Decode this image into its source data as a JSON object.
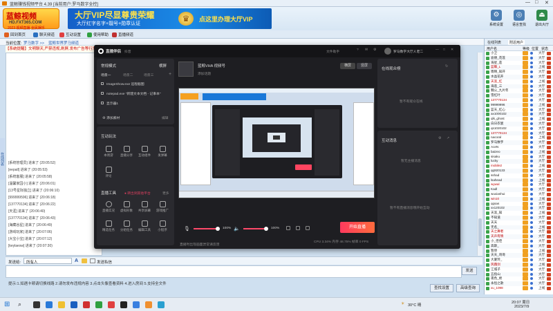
{
  "window": {
    "title": "蓝鲸赚钱视频平台 4.39 [当前用户:罗马数字全控]",
    "minimize": "—",
    "maximize": "□",
    "close": "✕"
  },
  "logo": {
    "line1": "蓝鲸视频",
    "line2": "HD.FXT365.COM",
    "line3": "2023 视频直播 全民娱乐"
  },
  "banner": {
    "line1": "大厅VIP尽显尊贵荣耀",
    "line2": "大厅红字名字+靓号+勋章认证",
    "line3": "点这里办理大厅VIP"
  },
  "topbuttons": [
    {
      "label": "系统设置",
      "icon": "gear-icon"
    },
    {
      "label": "语言查找",
      "icon": "globe-icon"
    },
    {
      "label": "退出大厅",
      "icon": "exit-icon"
    }
  ],
  "toolbar": {
    "items": [
      {
        "label": "回到首页",
        "color": "#e06020"
      },
      {
        "label": "聊天频道",
        "color": "#2a70c0"
      },
      {
        "label": "互动设置",
        "color": "#e04040"
      },
      {
        "label": "使用帮助",
        "color": "#30a040"
      },
      {
        "label": "直播频道",
        "color": "#c03030"
      }
    ]
  },
  "crumb": {
    "a": "当前位置:",
    "b": "罗马数字 >>",
    "c": "蓝鲸世界罗马频道"
  },
  "ticker": "【系统提醒】文明聊天,严禁违规,刷屏,发布广告等行为",
  "chat": [
    "[系统管理员] 进来了 (20:05:52)",
    "[eepall] 进来了 (20:05:53)",
    "[系统客服] 进来了 (20:05:58)",
    "[温馨家园小] 进来了 (20:06:01)",
    "[13号星际独立] 进来了 (20:06:10)",
    "[999999596] 进来了 (20:06:18)",
    "[137770134] 进来了 (20:06:22)",
    "[天涯] 进来了 (20:06:40)",
    "[137770134] 进来了 (20:06:43)",
    "[海藏谷星] 进来了 (20:06:49)",
    "[游戏玩家] 进来了 (20:07:06)",
    "[大宝小宝] 进来了 (20:07:12)",
    "[keylaesw] 进来了 (20:07:30)"
  ],
  "sidetab": "在线列表",
  "inputrow": {
    "label": "发送给:",
    "target": "所有人",
    "opt1": "A",
    "opt2": "私聊",
    "checkbox_label": "发送私信"
  },
  "send": "发送",
  "tip": "提示:1.如遇卡顿请切换线路  2.请勿发布违规内容 3.点击头像查看资料  4.进入房间  5.支持全文件",
  "bottombuttons": [
    "查找设置",
    "高级查询"
  ],
  "right": {
    "tabs": [
      "在线列表",
      "附近用户"
    ],
    "headers": [
      "用户名",
      "等级",
      "位置",
      "状态"
    ],
    "users": [
      {
        "name": "小卫",
        "st": "大厅"
      },
      {
        "name": "迪德_花莲",
        "st": "大厅"
      },
      {
        "name": "海星_莲",
        "st": "大厅"
      },
      {
        "name": "蓝蝶_L",
        "st": "上线"
      },
      {
        "name": "雨晴_知开",
        "st": "大厅"
      },
      {
        "name": "水晶花开",
        "st": "大厅"
      },
      {
        "name": "天涯_红",
        "st": "上线"
      },
      {
        "name": "海莲_三",
        "st": "大厅"
      },
      {
        "name": "魏公_九片年",
        "st": "大厅"
      },
      {
        "name": "雪红叶",
        "st": "大厅"
      },
      {
        "name": "137770134",
        "st": "大厅"
      },
      {
        "name": "99999996",
        "st": "上线"
      },
      {
        "name": "蓝天_红心",
        "st": "大厅"
      },
      {
        "name": "ax1000102",
        "st": "大厅"
      },
      {
        "name": "qlk_ghost",
        "st": "上线"
      },
      {
        "name": "白日衣裳",
        "st": "大厅"
      },
      {
        "name": "qs1020102",
        "st": "大厅"
      },
      {
        "name": "137770134",
        "st": "大厅"
      },
      {
        "name": "nacoral",
        "st": "上线"
      },
      {
        "name": "罗马数字",
        "st": "大厅"
      },
      {
        "name": "AceN",
        "st": "大厅"
      },
      {
        "name": "baizeo",
        "st": "上线"
      },
      {
        "name": "sisaku",
        "st": "大厅"
      },
      {
        "name": "lucky",
        "st": "大厅"
      },
      {
        "name": "mobile2",
        "st": "上线"
      },
      {
        "name": "qq920133",
        "st": "大厅"
      },
      {
        "name": "sshad",
        "st": "大厅"
      },
      {
        "name": "lsahead",
        "st": "上线"
      },
      {
        "name": "wywal",
        "st": "大厅"
      },
      {
        "name": "Kadl",
        "st": "大厅"
      },
      {
        "name": "wuxianhui",
        "st": "大厅"
      },
      {
        "name": "win10",
        "st": "上线"
      },
      {
        "name": "qqsas",
        "st": "大厅"
      },
      {
        "name": "xx120102",
        "st": "大厅"
      },
      {
        "name": "天涯_知",
        "st": "上线"
      },
      {
        "name": "不知道",
        "st": "大厅"
      },
      {
        "name": "天天",
        "st": "大厅"
      },
      {
        "name": "无名_",
        "st": "上线"
      },
      {
        "name": "天之舞者",
        "st": "大厅"
      },
      {
        "name": "天声有情",
        "st": "大厅"
      },
      {
        "name": "小_佳佳",
        "st": "大厅"
      },
      {
        "name": "高斯_",
        "st": "大厅"
      },
      {
        "name": "暂停",
        "st": "上线"
      },
      {
        "name": "天天_哥哥",
        "st": "大厅"
      },
      {
        "name": "大厦玲_",
        "st": "大厅"
      },
      {
        "name": "风霜剑",
        "st": "上线"
      },
      {
        "name": "江城子",
        "st": "大厅"
      },
      {
        "name": "五指山",
        "st": "大厅"
      },
      {
        "name": "夜色_绝",
        "st": "大厅"
      },
      {
        "name": "永恒之歌",
        "st": "大厅"
      },
      {
        "name": "xu_1098",
        "st": "上线"
      }
    ]
  },
  "obs": {
    "brand": "直播伴侣",
    "brand_sub": "抖音",
    "user": "罗马数字大厅人老二",
    "record": "文件助手",
    "scene_mode": "常规模式",
    "layout": "横屏",
    "scenes": [
      "场景一",
      "场景二",
      "场景三"
    ],
    "sources": [
      "ImageShow.exe 远程截图",
      "notepad.exe \"新建文本文档 - 记事本\"",
      "显示器1"
    ],
    "add_source": "添加素材",
    "edit": "编辑",
    "interact_title": "互动玩法",
    "interact_items": [
      "本周游",
      "直播分享",
      "互动组件",
      "发弹幕",
      "评论"
    ],
    "stream_tools_title": "直播工具",
    "stream_tools_hint": "● 转出到其他平台",
    "stream_tools_more": "更多",
    "tools": [
      "直播实况",
      "虚拟形象",
      "共享屏幕",
      "游戏推广",
      "精选任务",
      "分组任务",
      "编辑工具",
      "小程序"
    ],
    "account_name": "蓝鲸VHA 视频号",
    "account_sub": "添加话题",
    "tab_a": "横屏",
    "tab_b": "竖屏",
    "right_title1": "在线观众榜",
    "right_empty1": "暂不有观众在线",
    "right_title2": "互动消息",
    "right_empty2": "暂无主播消息",
    "right_empty3": "暂不有直播消息哦开始互动",
    "vol1": "100%",
    "vol2": "100%",
    "start": "开始直播",
    "stats": "CPU 3.34%  内存 48.75%  帧率 0 FPS",
    "warn": "直播时出现画面异常请反馈"
  },
  "taskbar": {
    "weather": "30°C 晴",
    "time": "20:07 周日",
    "date": "2023/7/9"
  }
}
